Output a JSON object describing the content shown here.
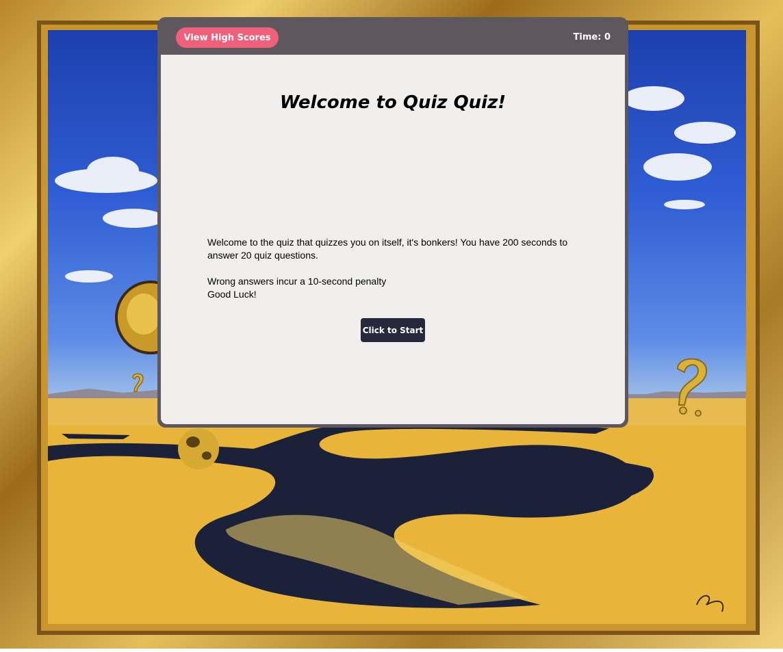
{
  "header": {
    "high_scores_label": "View High Scores",
    "time_label": "Time: ",
    "time_value": "0"
  },
  "main": {
    "title": "Welcome to Quiz Quiz!",
    "intro_line": "Welcome to the quiz that quizzes you on itself, it's bonkers! You have 200 seconds to answer 20 quiz questions.",
    "penalty_line": "Wrong answers incur a 10-second penalty",
    "luck_line": "Good Luck!",
    "start_label": "Click to Start"
  },
  "colors": {
    "header_bg": "#5e575d",
    "high_scores_bg": "#f0607a",
    "body_bg": "#f1efed",
    "start_bg": "#28283c"
  }
}
